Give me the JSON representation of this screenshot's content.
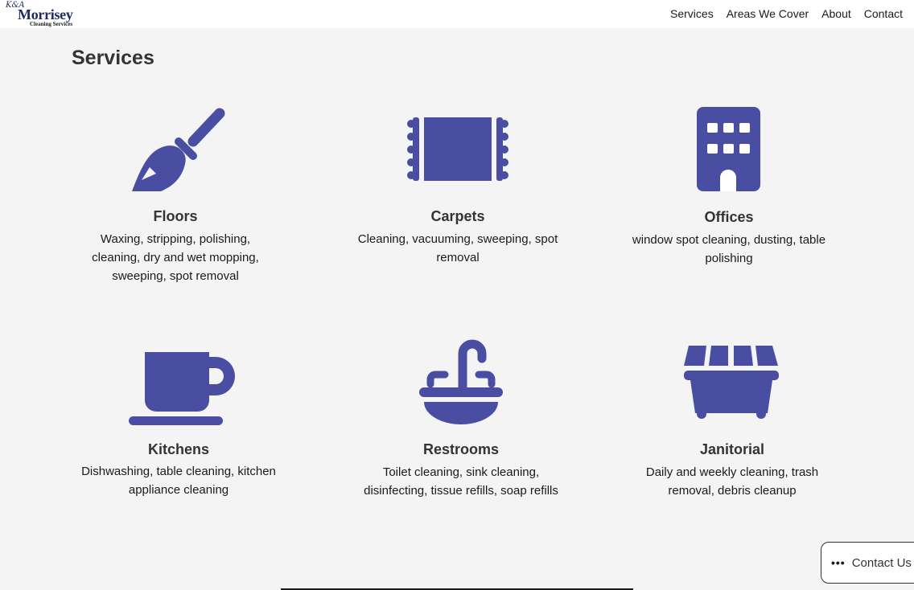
{
  "brand": {
    "script": "K&A",
    "name": "Morrisey",
    "sub": "Cleaning Services"
  },
  "nav": [
    "Services",
    "Areas We Cover",
    "About",
    "Contact"
  ],
  "page_title": "Services",
  "colors": {
    "accent": "#4a4ea3",
    "background": "#f4f4f4",
    "header": "#ffffff"
  },
  "services": [
    {
      "title": "Floors",
      "icon": "broom-icon",
      "desc": "Waxing, stripping, polishing, cleaning, dry and wet mopping, sweeping, spot removal"
    },
    {
      "title": "Carpets",
      "icon": "rug-icon",
      "desc": "Cleaning, vacuuming, sweeping, spot removal"
    },
    {
      "title": "Offices",
      "icon": "building-icon",
      "desc": "window spot cleaning, dusting, table polishing"
    },
    {
      "title": "Kitchens",
      "icon": "mug-icon",
      "desc": "Dishwashing, table cleaning, kitchen appliance cleaning"
    },
    {
      "title": "Restrooms",
      "icon": "sink-icon",
      "desc": "Toilet cleaning, sink cleaning, disinfecting, tissue refills, soap refills"
    },
    {
      "title": "Janitorial",
      "icon": "dumpster-icon",
      "desc": "Daily and weekly cleaning, trash removal, debris cleanup"
    }
  ],
  "contact_button": {
    "label": "Contact Us",
    "icon": "more-dots-icon"
  }
}
